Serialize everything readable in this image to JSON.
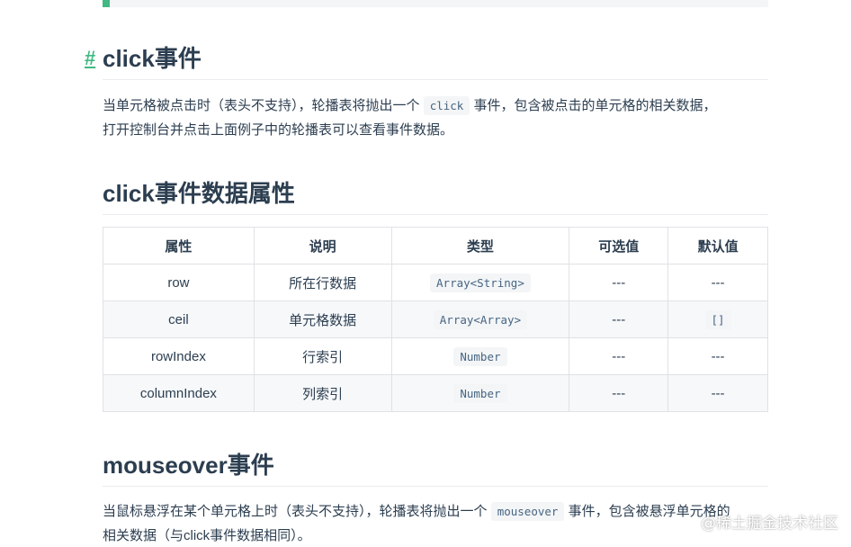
{
  "sections": {
    "click": {
      "anchor": "#",
      "title": "click事件",
      "para1_a": "当单元格被点击时（表头不支持），轮播表将抛出一个",
      "code": "click",
      "para1_b": "事件，包含被点击的单元格的相关数据，",
      "para2": "打开控制台并点击上面例子中的轮播表可以查看事件数据。"
    },
    "click_data": {
      "title": "click事件数据属性"
    },
    "mouseover": {
      "title": "mouseover事件",
      "para1_a": "当鼠标悬浮在某个单元格上时（表头不支持），轮播表将抛出一个",
      "code": "mouseover",
      "para1_b": "事件，包含被悬浮单元格的",
      "para2": "相关数据（与click事件数据相同）。"
    }
  },
  "table": {
    "headers": [
      "属性",
      "说明",
      "类型",
      "可选值",
      "默认值"
    ],
    "rows": [
      {
        "attr": "row",
        "desc": "所在行数据",
        "type": "Array<String>",
        "options": "---",
        "default": "---"
      },
      {
        "attr": "ceil",
        "desc": "单元格数据",
        "type": "Array<Array>",
        "options": "---",
        "default": "[]"
      },
      {
        "attr": "rowIndex",
        "desc": "行索引",
        "type": "Number",
        "options": "---",
        "default": "---"
      },
      {
        "attr": "columnIndex",
        "desc": "列索引",
        "type": "Number",
        "options": "---",
        "default": "---"
      }
    ]
  },
  "watermark": "@稀土掘金技术社区",
  "colors": {
    "accent": "#42b983",
    "text": "#2c3e50",
    "code_text": "#476582",
    "code_bg": "#f3f5f7",
    "border": "#dfe2e5",
    "stripe": "#f6f8fa"
  }
}
